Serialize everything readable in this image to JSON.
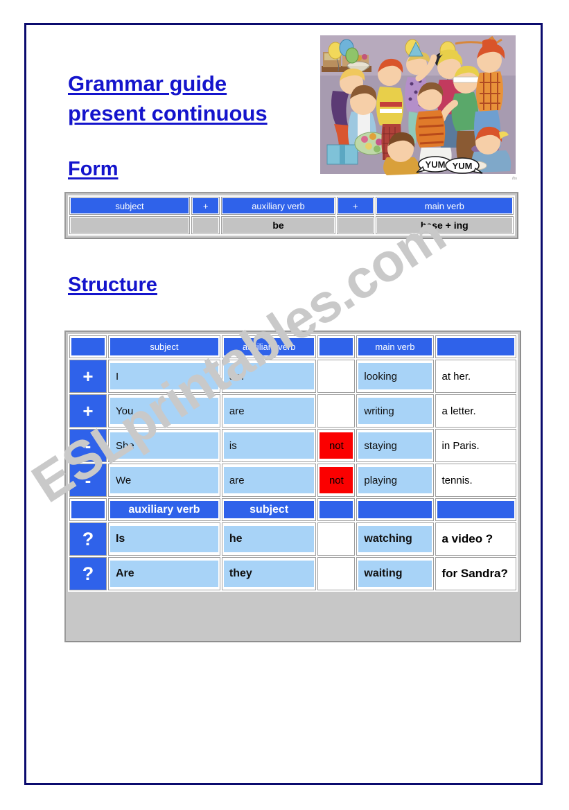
{
  "page": {
    "title_line1": "Grammar guide",
    "title_line2": "present continuous",
    "form_heading": "Form",
    "structure_heading": "Structure",
    "watermark": "ESLprintables.com",
    "illustration_credit": "ihs"
  },
  "colors": {
    "heading_blue": "#1414cc",
    "header_blue": "#2f62ea",
    "light_blue_cell": "#a8d3f7",
    "negative_red": "#fb0000",
    "form_value_gray": "#c3c3c3",
    "page_border_navy": "#0b0b6e",
    "watermark_gray": "#c9c9c9"
  },
  "form_table": {
    "headers": [
      "subject",
      "+",
      "auxiliary verb",
      "+",
      "main verb"
    ],
    "values": [
      "",
      "",
      "be",
      "",
      "base + ing"
    ]
  },
  "structure_table": {
    "header_affirmative": [
      "",
      "subject",
      "auxiliary verb",
      "",
      "main verb",
      ""
    ],
    "header_question": [
      "",
      "auxiliary verb",
      "subject",
      "",
      "",
      ""
    ],
    "rows": [
      {
        "symbol": "+",
        "symbol_name": "plus",
        "subject": "I",
        "auxiliary": "am",
        "not": "",
        "main_verb": "looking",
        "rest": "at her.",
        "bold": false
      },
      {
        "symbol": "+",
        "symbol_name": "plus",
        "subject": "You",
        "auxiliary": "are",
        "not": "",
        "main_verb": "writing",
        "rest": "a letter.",
        "bold": false
      },
      {
        "symbol": "-",
        "symbol_name": "minus",
        "subject": "She",
        "auxiliary": "is",
        "not": "not",
        "main_verb": "staying",
        "rest": "in Paris.",
        "bold": false
      },
      {
        "symbol": "-",
        "symbol_name": "minus",
        "subject": "We",
        "auxiliary": "are",
        "not": "not",
        "main_verb": "playing",
        "rest": "tennis.",
        "bold": false
      }
    ],
    "question_rows": [
      {
        "symbol": "?",
        "symbol_name": "question",
        "auxiliary": "Is",
        "subject": "he",
        "not": "",
        "main_verb": "watching",
        "rest": "a video ?",
        "bold": true
      },
      {
        "symbol": "?",
        "symbol_name": "question",
        "auxiliary": "Are",
        "subject": "they",
        "not": "",
        "main_verb": "waiting",
        "rest": "for Sandra?",
        "bold": true
      }
    ]
  }
}
